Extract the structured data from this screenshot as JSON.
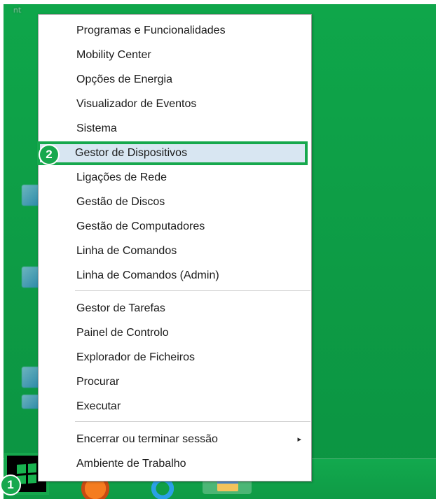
{
  "desktop": {
    "labels": [
      "nt"
    ],
    "icons": [
      "shortcut-icon",
      "shortcut-icon",
      "shortcut-icon",
      "shortcut-icon"
    ]
  },
  "menu": {
    "groups": [
      [
        "Programas e Funcionalidades",
        "Mobility Center",
        "Opções de Energia",
        "Visualizador de Eventos",
        "Sistema",
        "Gestor de Dispositivos",
        "Ligações de Rede",
        "Gestão de Discos",
        "Gestão de Computadores",
        "Linha de Comandos",
        "Linha de Comandos (Admin)"
      ],
      [
        "Gestor de Tarefas",
        "Painel de Controlo",
        "Explorador de Ficheiros",
        "Procurar",
        "Executar"
      ],
      [
        "Encerrar ou terminar sessão",
        "Ambiente de Trabalho"
      ]
    ],
    "highlighted_item": "Gestor de Dispositivos",
    "submenu_indicator": "▸"
  },
  "annotations": {
    "step1": "1",
    "step2": "2"
  },
  "taskbar": {
    "start_icon": "windows-logo-icon",
    "apps": [
      "firefox-icon",
      "internet-explorer-icon",
      "file-explorer-icon"
    ]
  },
  "colors": {
    "desktop": "#0fa64a",
    "accent": "#16a84d",
    "highlight": "#d8e6f2"
  }
}
